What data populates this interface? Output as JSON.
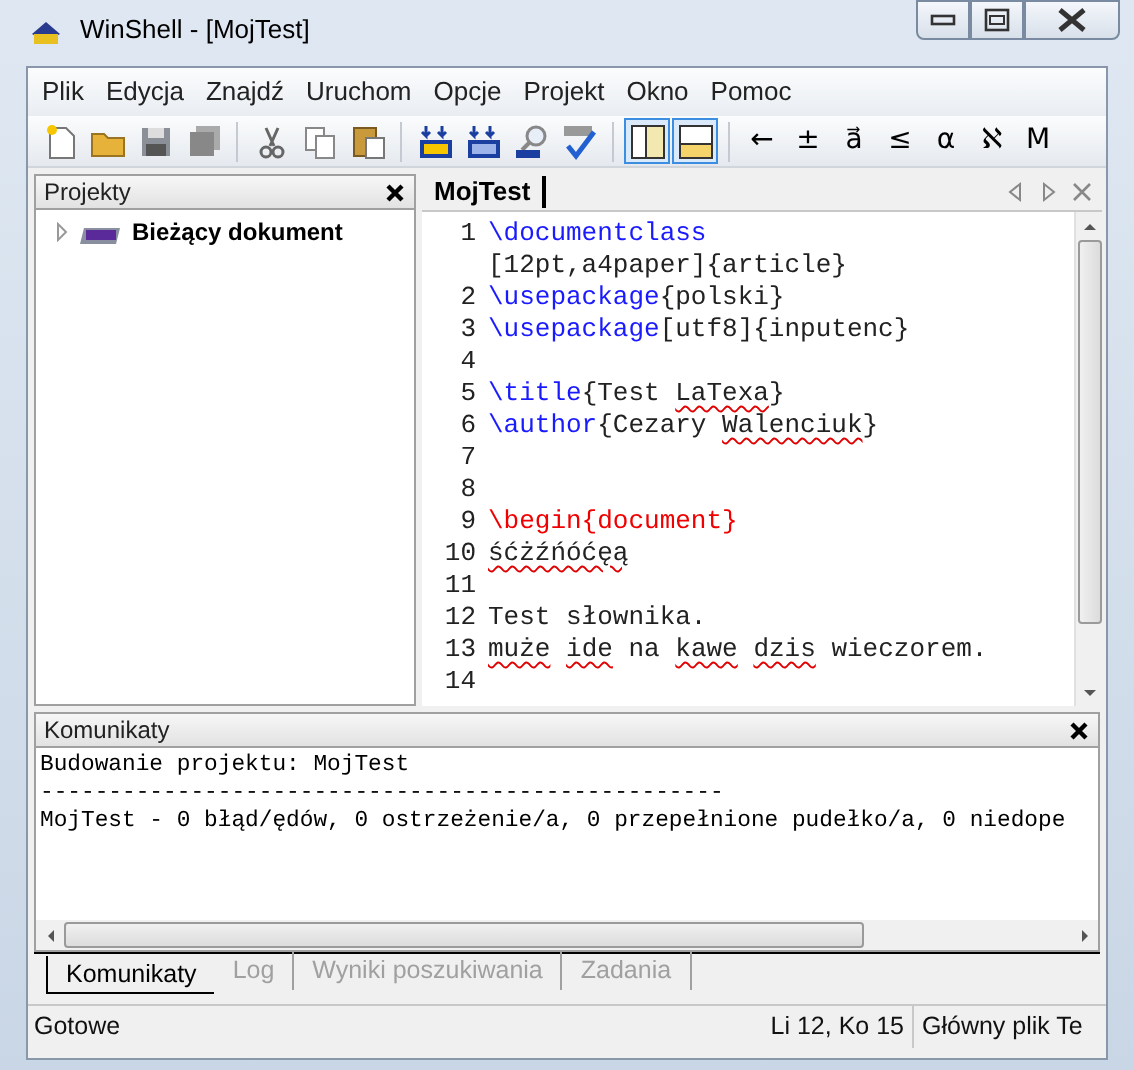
{
  "window": {
    "title": "WinShell - [MojTest]"
  },
  "menu": [
    {
      "label": "Plik"
    },
    {
      "label": "Edycja"
    },
    {
      "label": "Znajdź"
    },
    {
      "label": "Uruchom"
    },
    {
      "label": "Opcje"
    },
    {
      "label": "Projekt"
    },
    {
      "label": "Okno"
    },
    {
      "label": "Pomoc"
    }
  ],
  "toolbar": [
    {
      "kind": "new"
    },
    {
      "kind": "open"
    },
    {
      "kind": "save"
    },
    {
      "kind": "save-all"
    },
    {
      "kind": "separator"
    },
    {
      "kind": "cut"
    },
    {
      "kind": "copy"
    },
    {
      "kind": "paste"
    },
    {
      "kind": "separator"
    },
    {
      "kind": "pdf-build"
    },
    {
      "kind": "bib-build"
    },
    {
      "kind": "pdf-view"
    },
    {
      "kind": "spell"
    },
    {
      "kind": "separator"
    },
    {
      "kind": "pane-left",
      "pressed": true
    },
    {
      "kind": "pane-bottom",
      "pressed": true
    },
    {
      "kind": "separator"
    },
    {
      "kind": "symbol",
      "text": "←"
    },
    {
      "kind": "symbol",
      "text": "±"
    },
    {
      "kind": "symbol",
      "text": "a⃗"
    },
    {
      "kind": "symbol",
      "text": "≤"
    },
    {
      "kind": "symbol",
      "text": "α"
    },
    {
      "kind": "symbol",
      "text": "ℵ"
    },
    {
      "kind": "symbol",
      "text": "M"
    }
  ],
  "projects_panel": {
    "title": "Projekty",
    "tree": [
      {
        "label": "Bieżący dokument",
        "expanded": false
      }
    ]
  },
  "editor": {
    "tab": "MojTest",
    "lines": [
      {
        "number": "1",
        "segments": [
          {
            "text": "\\documentclass",
            "kind": "command"
          }
        ]
      },
      {
        "segments": [
          {
            "text": "[12pt,a4paper]{article}",
            "kind": "plain"
          }
        ]
      },
      {
        "number": "2",
        "segments": [
          {
            "text": "\\usepackage",
            "kind": "command"
          },
          {
            "text": "{polski}",
            "kind": "plain"
          }
        ]
      },
      {
        "number": "3",
        "segments": [
          {
            "text": "\\usepackage",
            "kind": "command"
          },
          {
            "text": "[utf8]{inputenc}",
            "kind": "plain"
          }
        ]
      },
      {
        "number": "4"
      },
      {
        "number": "5",
        "segments": [
          {
            "text": "\\title",
            "kind": "command"
          },
          {
            "text": "{Test ",
            "kind": "plain"
          },
          {
            "text": "LaTexa",
            "kind": "misspelled"
          },
          {
            "text": "}",
            "kind": "plain"
          }
        ]
      },
      {
        "number": "6",
        "segments": [
          {
            "text": "\\author",
            "kind": "command"
          },
          {
            "text": "{Cezary ",
            "kind": "plain"
          },
          {
            "text": "Walenciuk",
            "kind": "misspelled"
          },
          {
            "text": "}",
            "kind": "plain"
          }
        ]
      },
      {
        "number": "7"
      },
      {
        "number": "8"
      },
      {
        "number": "9",
        "segments": [
          {
            "text": "\\begin{document}",
            "kind": "environment"
          }
        ]
      },
      {
        "number": "10",
        "segments": [
          {
            "text": "śćżźńóćęą",
            "kind": "misspelled"
          }
        ]
      },
      {
        "number": "11"
      },
      {
        "number": "12",
        "segments": [
          {
            "text": "Test słownika.",
            "kind": "plain"
          }
        ]
      },
      {
        "number": "13",
        "segments": [
          {
            "text": "muże",
            "kind": "misspelled"
          },
          {
            "text": " ide",
            "kind": "misspelled"
          },
          {
            "text": " na ",
            "kind": "plain"
          },
          {
            "text": "kawe",
            "kind": "misspelled"
          },
          {
            "text": " dzis",
            "kind": "misspelled"
          },
          {
            "text": " wieczorem.",
            "kind": "plain"
          }
        ]
      },
      {
        "number": "14"
      }
    ]
  },
  "messages_panel": {
    "title": "Komunikaty",
    "lines": [
      "Budowanie projektu: MojTest",
      "--------------------------------------------------",
      "MojTest - 0 błąd/ędów, 0 ostrzeżenie/a, 0 przepełnione pudełko/a, 0 niedope"
    ]
  },
  "bottom_tabs": [
    {
      "label": "Komunikaty",
      "selected": true
    },
    {
      "label": "Log",
      "selected": false
    },
    {
      "label": "Wyniki poszukiwania",
      "selected": false
    },
    {
      "label": "Zadania",
      "selected": false
    }
  ],
  "status_bar": {
    "status": "Gotowe",
    "position": "Li 12, Ko 15",
    "file": "Główny plik Te"
  }
}
